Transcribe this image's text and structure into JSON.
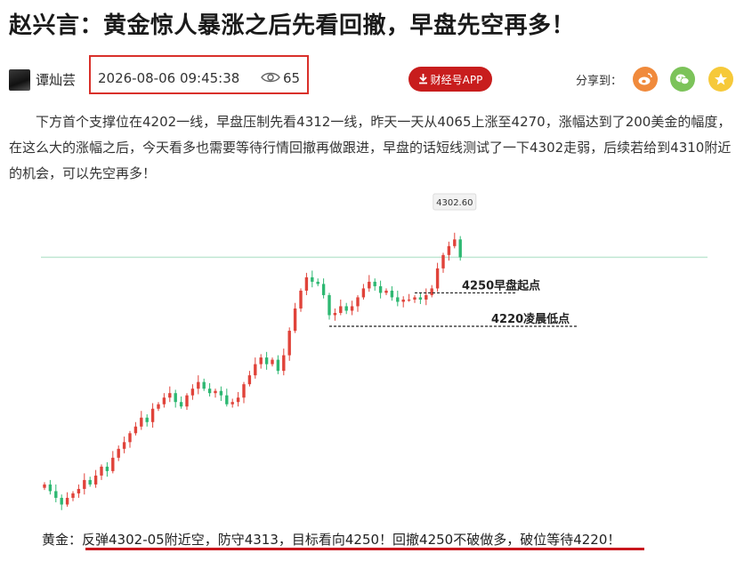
{
  "article": {
    "title": "赵兴言：黄金惊人暴涨之后先看回撤，早盘先空再多！",
    "author": "谭灿芸",
    "datetime": "2026-08-06 09:45:38",
    "views": "65",
    "app_button_label": "财经号APP",
    "share_label": "分享到：",
    "share_targets": [
      "weibo-icon",
      "wechat-icon",
      "star-icon"
    ],
    "body": "下方首个支撑位在4202一线，早盘压制先看4312一线，昨天一天从4065上涨至4270，涨幅达到了200美金的幅度，在这么大的涨幅之后，今天看多也需要等待行情回撤再做跟进，早盘的话短线测试了一下4302走弱，后续若给到4310附近的机会，可以先空再多！",
    "conclusion_prefix": "黄金：",
    "conclusion": "反弹4302-05附近空，防守4313，目标看向4250！回撤4250不破做多，破位等待4220！"
  },
  "colors": {
    "brand_red": "#c81d1d",
    "highlight_border": "#d9302a",
    "candle_up": "#e0433a",
    "candle_down": "#2eb872",
    "weibo": "#f08a3c",
    "wechat": "#7cc35a",
    "favorite": "#f6c93a"
  },
  "chart_data": {
    "type": "candlestick",
    "instrument": "黄金",
    "high_label": "4302.60",
    "ylim": [
      4050,
      4315
    ],
    "annotations": [
      {
        "text": "4250早盘起点",
        "value": 4250
      },
      {
        "text": "4220凌晨低点",
        "value": 4220
      }
    ],
    "series": [
      {
        "values": [
          4078,
          4072,
          4066,
          4060,
          4066,
          4070,
          4074,
          4082,
          4078,
          4086,
          4094,
          4090,
          4102,
          4110,
          4116,
          4124,
          4130,
          4138,
          4134,
          4146,
          4150,
          4156,
          4160,
          4152,
          4148,
          4158,
          4164,
          4170,
          4164,
          4160,
          4162,
          4158,
          4150,
          4152,
          4156,
          4168,
          4176,
          4186,
          4192,
          4186,
          4190,
          4180,
          4194,
          4216,
          4236,
          4252,
          4264,
          4260,
          4258,
          4248,
          4230,
          4232,
          4238,
          4234,
          4238,
          4246,
          4254,
          4260,
          4256,
          4250,
          4252,
          4246,
          4242,
          4244,
          4244,
          4246,
          4244,
          4248,
          4254,
          4272,
          4284,
          4292,
          4298,
          4282
        ]
      }
    ]
  }
}
